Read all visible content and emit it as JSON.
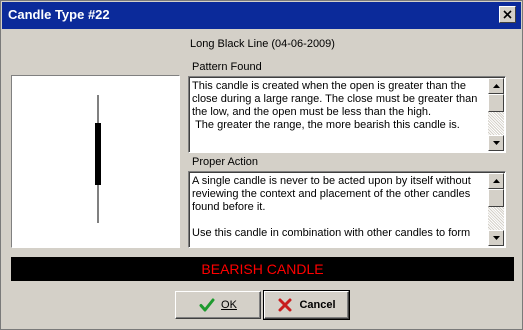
{
  "window": {
    "title": "Candle Type #22",
    "subtitle": "Long Black Line (04-06-2009)"
  },
  "pattern_found": {
    "label": "Pattern Found",
    "text": "This candle is created when the open is greater than the\nclose during a large range. The close must be greater than\nthe low, and the open must be less than the high.\n The greater the range, the more bearish this candle is."
  },
  "proper_action": {
    "label": "Proper Action",
    "text": "A single candle is never to be acted upon by itself without\nreviewing the context and placement of the other candles\nfound before it.\n\nUse this candle in combination with other candles to form"
  },
  "banner": {
    "text": "BEARISH CANDLE",
    "color": "#ff0000"
  },
  "buttons": {
    "ok_label": "OK",
    "cancel_label": "Cancel"
  },
  "icons": {
    "close": "close-icon",
    "ok": "checkmark-icon",
    "cancel": "x-icon"
  }
}
